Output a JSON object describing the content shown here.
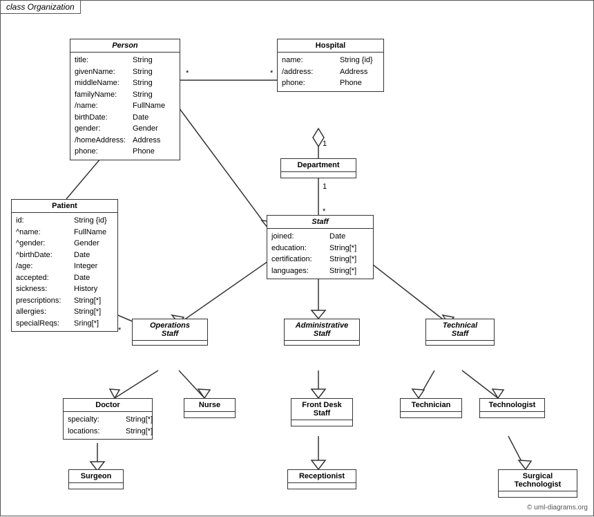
{
  "title": "class Organization",
  "classes": {
    "person": {
      "name": "Person",
      "italic": true,
      "attrs": [
        {
          "name": "title:",
          "type": "String"
        },
        {
          "name": "givenName:",
          "type": "String"
        },
        {
          "name": "middleName:",
          "type": "String"
        },
        {
          "name": "familyName:",
          "type": "String"
        },
        {
          "name": "/name:",
          "type": "FullName"
        },
        {
          "name": "birthDate:",
          "type": "Date"
        },
        {
          "name": "gender:",
          "type": "Gender"
        },
        {
          "name": "/homeAddress:",
          "type": "Address"
        },
        {
          "name": "phone:",
          "type": "Phone"
        }
      ]
    },
    "hospital": {
      "name": "Hospital",
      "italic": false,
      "attrs": [
        {
          "name": "name:",
          "type": "String {id}"
        },
        {
          "name": "/address:",
          "type": "Address"
        },
        {
          "name": "phone:",
          "type": "Phone"
        }
      ]
    },
    "department": {
      "name": "Department",
      "italic": false,
      "attrs": []
    },
    "staff": {
      "name": "Staff",
      "italic": true,
      "attrs": [
        {
          "name": "joined:",
          "type": "Date"
        },
        {
          "name": "education:",
          "type": "String[*]"
        },
        {
          "name": "certification:",
          "type": "String[*]"
        },
        {
          "name": "languages:",
          "type": "String[*]"
        }
      ]
    },
    "patient": {
      "name": "Patient",
      "italic": false,
      "attrs": [
        {
          "name": "id:",
          "type": "String {id}"
        },
        {
          "name": "^name:",
          "type": "FullName"
        },
        {
          "name": "^gender:",
          "type": "Gender"
        },
        {
          "name": "^birthDate:",
          "type": "Date"
        },
        {
          "name": "/age:",
          "type": "Integer"
        },
        {
          "name": "accepted:",
          "type": "Date"
        },
        {
          "name": "sickness:",
          "type": "History"
        },
        {
          "name": "prescriptions:",
          "type": "String[*]"
        },
        {
          "name": "allergies:",
          "type": "String[*]"
        },
        {
          "name": "specialReqs:",
          "type": "Sring[*]"
        }
      ]
    },
    "operations_staff": {
      "name": "Operations\nStaff",
      "italic": true,
      "attrs": []
    },
    "administrative_staff": {
      "name": "Administrative\nStaff",
      "italic": true,
      "attrs": []
    },
    "technical_staff": {
      "name": "Technical\nStaff",
      "italic": true,
      "attrs": []
    },
    "doctor": {
      "name": "Doctor",
      "italic": false,
      "attrs": [
        {
          "name": "specialty:",
          "type": "String[*]"
        },
        {
          "name": "locations:",
          "type": "String[*]"
        }
      ]
    },
    "nurse": {
      "name": "Nurse",
      "italic": false,
      "attrs": []
    },
    "front_desk_staff": {
      "name": "Front Desk\nStaff",
      "italic": false,
      "attrs": []
    },
    "technician": {
      "name": "Technician",
      "italic": false,
      "attrs": []
    },
    "technologist": {
      "name": "Technologist",
      "italic": false,
      "attrs": []
    },
    "surgeon": {
      "name": "Surgeon",
      "italic": false,
      "attrs": []
    },
    "receptionist": {
      "name": "Receptionist",
      "italic": false,
      "attrs": []
    },
    "surgical_technologist": {
      "name": "Surgical\nTechnologist",
      "italic": false,
      "attrs": []
    }
  },
  "copyright": "© uml-diagrams.org"
}
